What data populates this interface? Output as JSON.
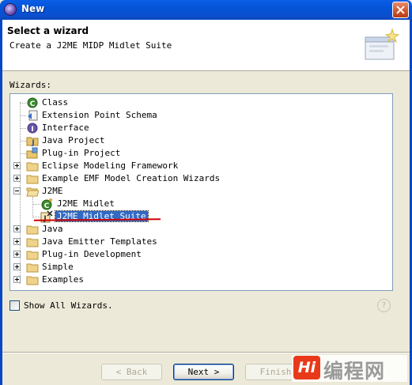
{
  "window": {
    "title": "New"
  },
  "banner": {
    "title": "Select a wizard",
    "description": "Create a J2ME MIDP Midlet Suite"
  },
  "wizards_label": "Wizards:",
  "tree": {
    "items": [
      {
        "label": "Class",
        "icon": "class-icon",
        "level": 1,
        "expander": "none"
      },
      {
        "label": "Extension Point Schema",
        "icon": "schema-icon",
        "level": 1,
        "expander": "none"
      },
      {
        "label": "Interface",
        "icon": "interface-icon",
        "level": 1,
        "expander": "none"
      },
      {
        "label": "Java Project",
        "icon": "java-project-icon",
        "level": 1,
        "expander": "none"
      },
      {
        "label": "Plug-in Project",
        "icon": "plugin-project-icon",
        "level": 1,
        "expander": "none"
      },
      {
        "label": "Eclipse Modeling Framework",
        "icon": "folder-icon",
        "level": 0,
        "expander": "plus"
      },
      {
        "label": "Example EMF Model Creation Wizards",
        "icon": "folder-icon",
        "level": 0,
        "expander": "plus"
      },
      {
        "label": "J2ME",
        "icon": "folder-open-icon",
        "level": 0,
        "expander": "minus"
      },
      {
        "label": "J2ME Midlet",
        "icon": "midlet-icon",
        "level": 2,
        "expander": "none"
      },
      {
        "label": "J2ME Midlet Suite",
        "icon": "midlet-suite-icon",
        "level": 2,
        "expander": "none",
        "selected": true
      },
      {
        "label": "Java",
        "icon": "folder-icon",
        "level": 0,
        "expander": "plus"
      },
      {
        "label": "Java Emitter Templates",
        "icon": "folder-icon",
        "level": 0,
        "expander": "plus"
      },
      {
        "label": "Plug-in Development",
        "icon": "folder-icon",
        "level": 0,
        "expander": "plus"
      },
      {
        "label": "Simple",
        "icon": "folder-icon",
        "level": 0,
        "expander": "plus"
      },
      {
        "label": "Examples",
        "icon": "folder-icon",
        "level": 0,
        "expander": "plus"
      }
    ]
  },
  "show_all": {
    "label": "Show All Wizards.",
    "checked": false
  },
  "buttons": {
    "back": "< Back",
    "next": "Next >",
    "finish": "Finish"
  },
  "watermark": {
    "logo": "Hi",
    "text": "编程网"
  }
}
